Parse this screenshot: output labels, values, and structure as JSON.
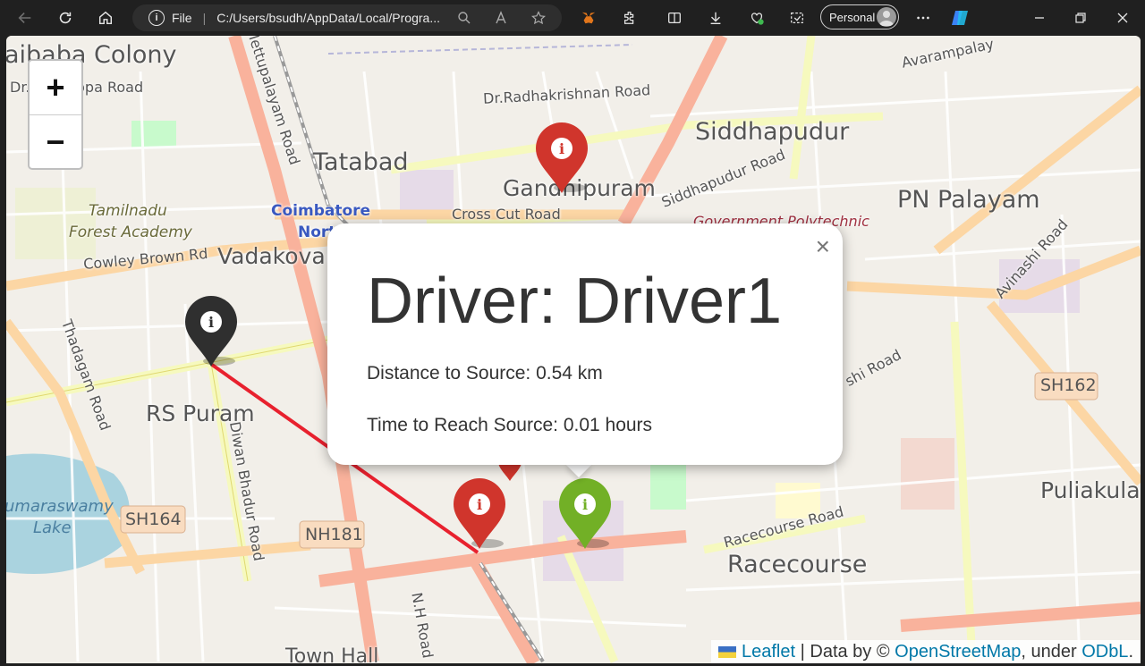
{
  "browser": {
    "address_scheme": "File",
    "address_url": "C:/Users/bsudh/AppData/Local/Progra...",
    "profile_label": "Personal",
    "address_info_glyph": "i"
  },
  "map": {
    "zoom_in_label": "+",
    "zoom_out_label": "−",
    "place_labels": [
      "aibaba Colony",
      "Dr. Nanjappa Road",
      "Dr.Radhakrishnan Road",
      "Siddhapudur",
      "Tatabad",
      "Gandhipuram",
      "Siddhapudur Road",
      "Cross Cut Road",
      "PN Palayam",
      "Government Polytechnic",
      "Coimbatore",
      "North",
      "Tamilnadu",
      "Forest Academy",
      "Cowley Brown Rd",
      "Vadakovai",
      "Avinashi Road",
      "Thadagam Road",
      "RS Puram",
      "Diwan Bhadur Road",
      "SH162",
      "SH164",
      "NH181",
      "umaraswamy",
      "Lake",
      "Racecourse Road",
      "Racecourse",
      "Puliakulam",
      "N.H Road",
      "Town Hall",
      "Avarampalay",
      "Mettupalayam Road",
      "shi Road"
    ],
    "route_color": "#e8212e",
    "markers": [
      {
        "color": "#d0352c",
        "label": "Gandhipuram marker"
      },
      {
        "color": "#2f2f2f",
        "label": "RS Puram marker"
      },
      {
        "color": "#d0352c",
        "label": "Station marker"
      },
      {
        "color": "#72b026",
        "label": "Green marker"
      }
    ]
  },
  "popup": {
    "close": "×",
    "title": "Driver: Driver1",
    "distance": "Distance to Source: 0.54 km",
    "time": "Time to Reach Source: 0.01 hours"
  },
  "attribution": {
    "leaflet": "Leaflet",
    "sep": " | Data by © ",
    "osm": "OpenStreetMap",
    "under": ", under ",
    "odbl": "ODbL",
    "end": "."
  }
}
